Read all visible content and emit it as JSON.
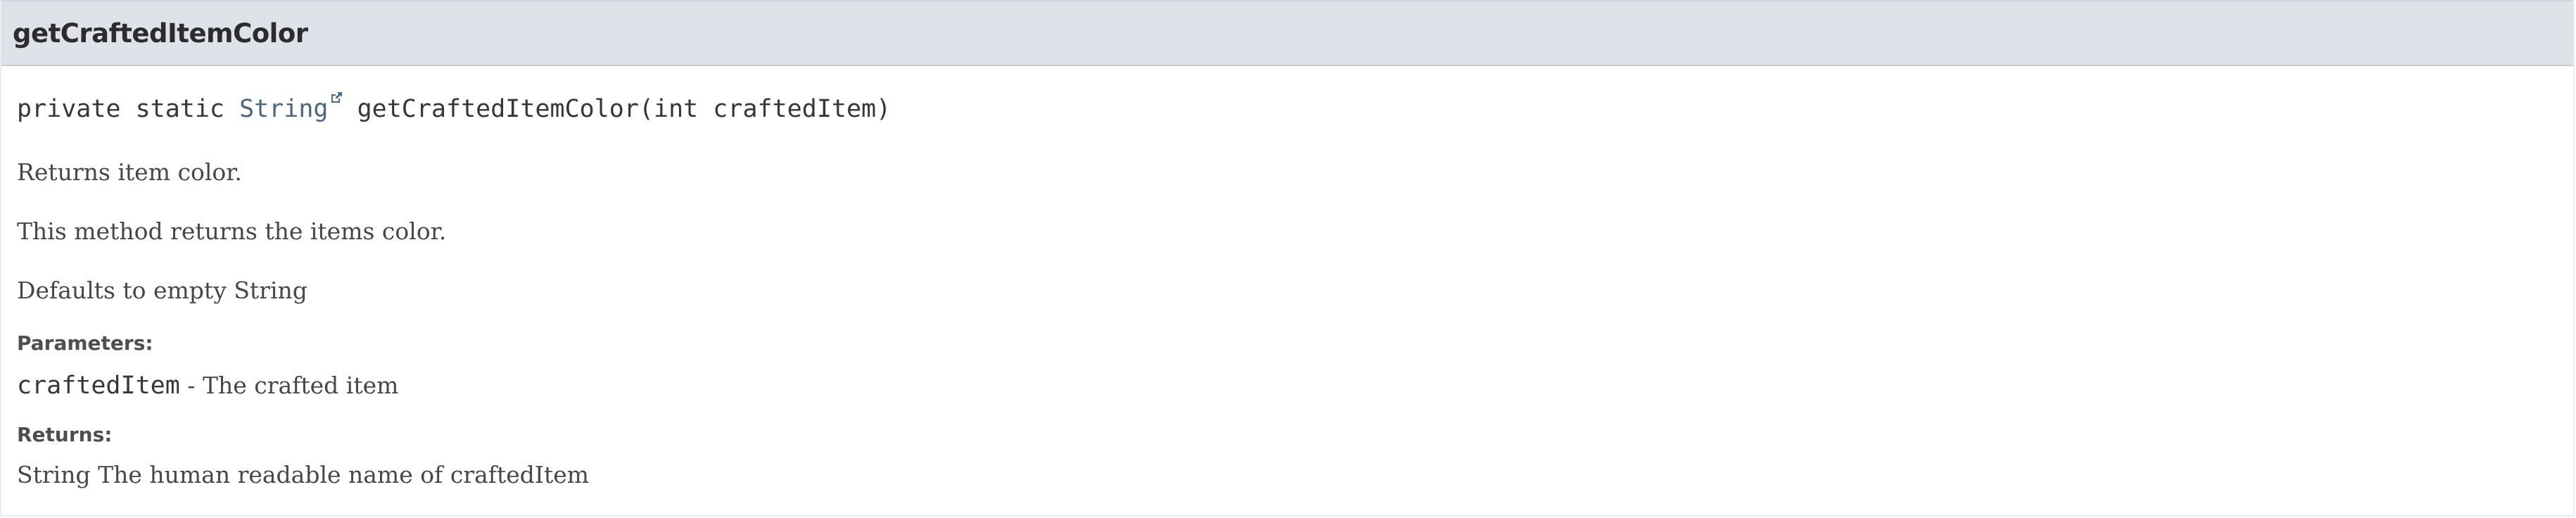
{
  "header": {
    "method_name": "getCraftedItemColor"
  },
  "signature": {
    "modifiers": "private static ",
    "return_type": "String",
    "method_call": " getCraftedItemColor(int craftedItem)"
  },
  "description": {
    "summary": "Returns item color.",
    "detail": "This method returns the items color.",
    "default_note": "Defaults to empty String"
  },
  "parameters": {
    "label": "Parameters:",
    "name": "craftedItem",
    "separator": " - ",
    "description": "The crafted item"
  },
  "returns": {
    "label": "Returns:",
    "text": "String The human readable name of craftedItem"
  },
  "icons": {
    "external_link": "external-link-icon"
  },
  "colors": {
    "header_bg": "#dee3e9",
    "link": "#4a6782",
    "text": "#474747"
  }
}
